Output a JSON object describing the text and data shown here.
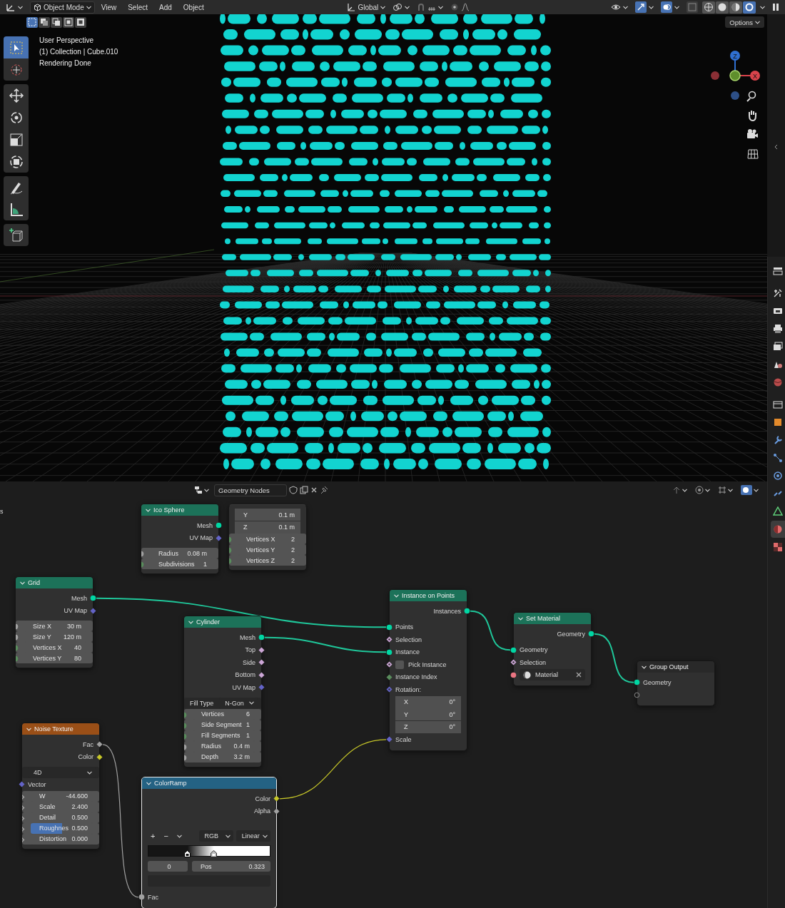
{
  "top_bar": {
    "mode": "Object Mode",
    "menus": [
      "View",
      "Select",
      "Add",
      "Object"
    ],
    "orientation": "Global",
    "gizmos": {
      "on": true
    },
    "overlays": {
      "on": true
    },
    "xray": {
      "on": false
    },
    "shading_modes": [
      {
        "selected": false
      },
      {
        "selected": false
      },
      {
        "selected": false
      },
      {
        "selected": true
      }
    ]
  },
  "viewport": {
    "options": "Options",
    "select_modes": [
      {
        "selected": true
      },
      {
        "selected": false
      },
      {
        "selected": false
      },
      {
        "selected": false
      },
      {
        "selected": false
      }
    ],
    "overlay_lines": [
      "User Perspective",
      "(1) Collection | Cube.010",
      "Rendering Done"
    ],
    "tools": [
      {
        "kind": "select_box",
        "selected": true
      },
      {
        "kind": "cursor",
        "selected": false
      },
      {
        "kind": "move",
        "selected": false
      },
      {
        "kind": "rotate",
        "selected": false
      },
      {
        "kind": "scale",
        "selected": false
      },
      {
        "kind": "transform",
        "selected": false
      },
      {
        "kind": "annotate",
        "selected": false
      },
      {
        "kind": "measure",
        "selected": false
      },
      {
        "kind": "add_cube",
        "selected": false
      }
    ],
    "gizmo_labels": [
      "Z",
      "X"
    ]
  },
  "node_editor": {
    "tree_name": "Geometry Nodes",
    "edge_text": "s",
    "nodes": [
      {
        "title": "Ico Sphere",
        "kind": "geometry",
        "selected": false,
        "rows": [
          {
            "kind": "output",
            "label": "Mesh",
            "socket": {
              "kind": "circle",
              "color": "#00d6a3"
            }
          },
          {
            "kind": "output",
            "label": "UV Map",
            "socket": {
              "kind": "diamond",
              "color": "#6363c7"
            }
          },
          {
            "kind": "field",
            "label": "Radius",
            "value": "0.08 m",
            "socket": {
              "kind": "circle",
              "color": "#a1a1a1"
            }
          },
          {
            "kind": "field",
            "label": "Subdivisions",
            "value": "1",
            "socket": {
              "kind": "circle",
              "color": "#598c5c"
            }
          }
        ]
      },
      {
        "kind": "fragment",
        "selected": false,
        "rows": [
          {
            "kind": "component",
            "label": "Y",
            "value": "0.1 m"
          },
          {
            "kind": "component",
            "label": "Z",
            "value": "0.1 m"
          },
          {
            "kind": "field",
            "label": "Vertices X",
            "value": "2",
            "socket": {
              "kind": "circle",
              "color": "#598c5c"
            }
          },
          {
            "kind": "field",
            "label": "Vertices Y",
            "value": "2",
            "socket": {
              "kind": "circle",
              "color": "#598c5c"
            }
          },
          {
            "kind": "field",
            "label": "Vertices Z",
            "value": "2",
            "socket": {
              "kind": "circle",
              "color": "#598c5c"
            }
          }
        ]
      },
      {
        "title": "Grid",
        "kind": "geometry",
        "selected": false,
        "rows": [
          {
            "kind": "output",
            "label": "Mesh",
            "socket": {
              "kind": "circle",
              "color": "#00d6a3"
            }
          },
          {
            "kind": "output",
            "label": "UV Map",
            "socket": {
              "kind": "diamond",
              "color": "#6363c7"
            }
          },
          {
            "kind": "field",
            "label": "Size X",
            "value": "30 m",
            "socket": {
              "kind": "circle",
              "color": "#a1a1a1"
            }
          },
          {
            "kind": "field",
            "label": "Size Y",
            "value": "120 m",
            "socket": {
              "kind": "circle",
              "color": "#a1a1a1"
            }
          },
          {
            "kind": "field",
            "label": "Vertices X",
            "value": "40",
            "socket": {
              "kind": "circle",
              "color": "#598c5c"
            }
          },
          {
            "kind": "field",
            "label": "Vertices Y",
            "value": "80",
            "socket": {
              "kind": "circle",
              "color": "#598c5c"
            }
          }
        ]
      },
      {
        "title": "Cylinder",
        "kind": "geometry",
        "selected": false,
        "rows": [
          {
            "kind": "output",
            "label": "Mesh",
            "socket": {
              "kind": "circle",
              "color": "#00d6a3"
            }
          },
          {
            "kind": "output",
            "label": "Top",
            "socket": {
              "kind": "diamond",
              "color": "#cca6d6"
            }
          },
          {
            "kind": "output",
            "label": "Side",
            "socket": {
              "kind": "diamond",
              "color": "#cca6d6"
            }
          },
          {
            "kind": "output",
            "label": "Bottom",
            "socket": {
              "kind": "diamond",
              "color": "#cca6d6"
            }
          },
          {
            "kind": "output",
            "label": "UV Map",
            "socket": {
              "kind": "diamond",
              "color": "#6363c7"
            }
          },
          {
            "kind": "dropdown",
            "label": "Fill Type",
            "value": "N-Gon"
          },
          {
            "kind": "field",
            "label": "Vertices",
            "value": "6",
            "socket": {
              "kind": "circle",
              "color": "#598c5c"
            }
          },
          {
            "kind": "field",
            "label": "Side Segment",
            "value": "1",
            "socket": {
              "kind": "circle",
              "color": "#598c5c"
            }
          },
          {
            "kind": "field",
            "label": "Fill Segments",
            "value": "1",
            "socket": {
              "kind": "circle",
              "color": "#598c5c"
            }
          },
          {
            "kind": "field",
            "label": "Radius",
            "value": "0.4 m",
            "socket": {
              "kind": "circle",
              "color": "#a1a1a1"
            }
          },
          {
            "kind": "field",
            "label": "Depth",
            "value": "3.2 m",
            "socket": {
              "kind": "circle",
              "color": "#a1a1a1"
            }
          }
        ]
      },
      {
        "title": "Noise Texture",
        "kind": "texture",
        "selected": false,
        "rows": [
          {
            "kind": "output",
            "label": "Fac",
            "socket": {
              "kind": "diamond",
              "color": "#a1a1a1"
            }
          },
          {
            "kind": "output",
            "label": "Color",
            "socket": {
              "kind": "diamond",
              "color": "#c7c729"
            }
          },
          {
            "kind": "dropdown",
            "value": "4D"
          },
          {
            "kind": "input",
            "label": "Vector",
            "socket": {
              "kind": "diamond",
              "color": "#6363c7"
            }
          },
          {
            "kind": "field",
            "label": "W",
            "value": "-44.600",
            "socket": {
              "kind": "diamond_dot",
              "color": "#a1a1a1"
            }
          },
          {
            "kind": "field",
            "label": "Scale",
            "value": "2.400",
            "socket": {
              "kind": "diamond_dot",
              "color": "#a1a1a1"
            }
          },
          {
            "kind": "field",
            "label": "Detail",
            "value": "0.500",
            "socket": {
              "kind": "diamond_dot",
              "color": "#a1a1a1"
            }
          },
          {
            "kind": "field",
            "label": "Roughnes",
            "value": "0.500",
            "level": 0.5,
            "socket": {
              "kind": "diamond_dot",
              "color": "#a1a1a1"
            }
          },
          {
            "kind": "field",
            "label": "Distortion",
            "value": "0.000",
            "socket": {
              "kind": "diamond_dot",
              "color": "#a1a1a1"
            }
          }
        ]
      },
      {
        "title": "ColorRamp",
        "kind": "converter",
        "selected": true,
        "rows": [
          {
            "kind": "output",
            "label": "Color",
            "socket": {
              "kind": "diamond",
              "color": "#c7c729"
            }
          },
          {
            "kind": "output",
            "label": "Alpha",
            "socket": {
              "kind": "diamond",
              "color": "#a1a1a1"
            }
          },
          {
            "kind": "ramp_controls",
            "add": "+",
            "remove": "−",
            "mode": "RGB",
            "interpolation": "Linear"
          },
          {
            "kind": "ramp_bar",
            "stops": [
              {
                "level": 0.323,
                "selected": true
              },
              {
                "level": 0.54,
                "selected": false
              }
            ]
          },
          {
            "kind": "ramp_stop_fields",
            "index": "0",
            "label": "Pos",
            "value": "0.323"
          },
          {
            "kind": "swatch"
          },
          {
            "kind": "input",
            "label": "Fac",
            "socket": {
              "kind": "circle",
              "color": "#a1a1a1"
            }
          }
        ]
      },
      {
        "title": "Instance on Points",
        "kind": "geometry",
        "selected": false,
        "rows": [
          {
            "kind": "output",
            "label": "Instances",
            "socket": {
              "kind": "circle",
              "color": "#00d6a3"
            }
          },
          {
            "kind": "input",
            "label": "Points",
            "socket": {
              "kind": "circle",
              "color": "#00d6a3"
            }
          },
          {
            "kind": "input",
            "label": "Selection",
            "socket": {
              "kind": "diamond_dot",
              "color": "#cca6d6"
            }
          },
          {
            "kind": "input",
            "label": "Instance",
            "socket": {
              "kind": "circle",
              "color": "#00d6a3"
            }
          },
          {
            "kind": "checkbox",
            "label": "Pick Instance",
            "checked": false,
            "socket": {
              "kind": "diamond_dot",
              "color": "#cca6d6"
            }
          },
          {
            "kind": "input",
            "label": "Instance Index",
            "socket": {
              "kind": "diamond",
              "color": "#598c5c"
            }
          },
          {
            "kind": "input",
            "label": "Rotation:",
            "socket": {
              "kind": "diamond_dot",
              "color": "#6363c7"
            }
          },
          {
            "kind": "component",
            "label": "X",
            "value": "0°"
          },
          {
            "kind": "component",
            "label": "Y",
            "value": "0°"
          },
          {
            "kind": "component",
            "label": "Z",
            "value": "0°"
          },
          {
            "kind": "input",
            "label": "Scale",
            "socket": {
              "kind": "diamond",
              "color": "#6363c7"
            }
          }
        ]
      },
      {
        "title": "Set Material",
        "kind": "geometry",
        "selected": false,
        "rows": [
          {
            "kind": "output",
            "label": "Geometry",
            "socket": {
              "kind": "circle",
              "color": "#00d6a3"
            }
          },
          {
            "kind": "input",
            "label": "Geometry",
            "socket": {
              "kind": "circle",
              "color": "#00d6a3"
            }
          },
          {
            "kind": "input",
            "label": "Selection",
            "socket": {
              "kind": "diamond_dot",
              "color": "#cca6d6"
            }
          },
          {
            "kind": "material",
            "label": "Material",
            "socket": {
              "kind": "circle",
              "color": "#eb7582"
            }
          }
        ]
      },
      {
        "title": "Group Output",
        "kind": "output",
        "selected": false,
        "rows": [
          {
            "kind": "input",
            "label": "Geometry",
            "socket": {
              "kind": "circle",
              "color": "#00d6a3"
            }
          },
          {
            "kind": "empty_socket"
          }
        ]
      }
    ]
  },
  "properties_tabs": [
    {
      "kind": "editor",
      "selected": false
    },
    {
      "kind": "tool",
      "selected": false
    },
    {
      "kind": "render",
      "selected": false
    },
    {
      "kind": "output",
      "selected": false
    },
    {
      "kind": "view_layer",
      "selected": false
    },
    {
      "kind": "scene",
      "selected": false
    },
    {
      "kind": "world",
      "selected": false
    },
    {
      "kind": "collection",
      "selected": false
    },
    {
      "kind": "object",
      "selected": false
    },
    {
      "kind": "modifier",
      "selected": false
    },
    {
      "kind": "particles",
      "selected": false
    },
    {
      "kind": "physics",
      "selected": false
    },
    {
      "kind": "constraints",
      "selected": false
    },
    {
      "kind": "data",
      "selected": false
    },
    {
      "kind": "material",
      "selected": true
    },
    {
      "kind": "texture",
      "selected": false
    }
  ]
}
